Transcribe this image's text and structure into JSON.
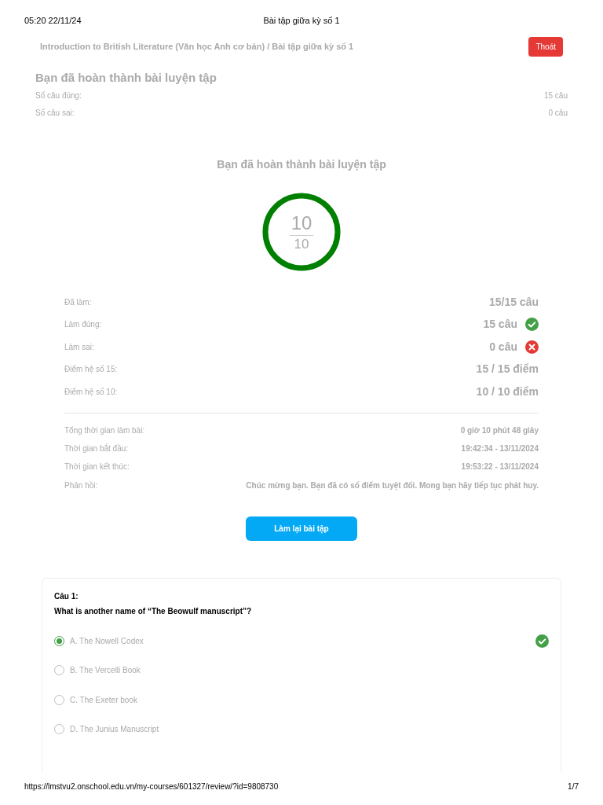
{
  "print_header": {
    "datetime": "05:20 22/11/24",
    "title": "Bài tập giữa kỳ số 1"
  },
  "breadcrumb": "Introduction to British Literature (Văn học Anh cơ bản) / Bài tập giữa kỳ số 1",
  "exit_button": "Thoát",
  "summary": {
    "heading": "Bạn đã hoàn thành bài luyện tập",
    "rows": [
      {
        "label": "Số câu đúng:",
        "value": "15 câu"
      },
      {
        "label": "Số câu sai:",
        "value": "0 câu"
      }
    ]
  },
  "result": {
    "title": "Bạn đã hoàn thành bài luyện tập",
    "score": "10",
    "max": "10",
    "stats": [
      {
        "label": "Đã làm:",
        "value": "15/15 câu",
        "kind": "plain"
      },
      {
        "label": "Làm đúng:",
        "value": "15 câu",
        "kind": "correct"
      },
      {
        "label": "Làm sai:",
        "value": "0 câu",
        "kind": "wrong"
      },
      {
        "label": "Điểm hệ số 15:",
        "value": "15 / 15 điểm",
        "kind": "plain"
      },
      {
        "label": "Điểm hệ số 10:",
        "value": "10 / 10 điểm",
        "kind": "plain"
      }
    ],
    "details": [
      {
        "label": "Tổng thời gian làm bài:",
        "value": "0 giờ 10 phút 48 giây"
      },
      {
        "label": "Thời gian bắt đầu:",
        "value": "19:42:34 - 13/11/2024"
      },
      {
        "label": "Thời gian kết thúc:",
        "value": "19:53:22 - 13/11/2024"
      },
      {
        "label": "Phản hồi:",
        "value": "Chúc mừng bạn. Bạn đã có số điểm tuyệt đối. Mong bạn hãy tiếp tục phát huy."
      }
    ],
    "retry_button": "Làm lại bài tập"
  },
  "question": {
    "number": "Câu 1:",
    "text": "What is another name of “The Beowulf manuscript”?",
    "options": [
      {
        "label": "A. The Nowell Codex",
        "selected": true,
        "correct": true
      },
      {
        "label": "B. The Vercelli Book",
        "selected": false,
        "correct": false
      },
      {
        "label": "C. The Exeter book",
        "selected": false,
        "correct": false
      },
      {
        "label": "D. The Junius Manuscript",
        "selected": false,
        "correct": false
      }
    ]
  },
  "print_footer": {
    "url": "https://lmstvu2.onschool.edu.vn/my-courses/601327/review/?id=9808730",
    "page": "1/7"
  }
}
